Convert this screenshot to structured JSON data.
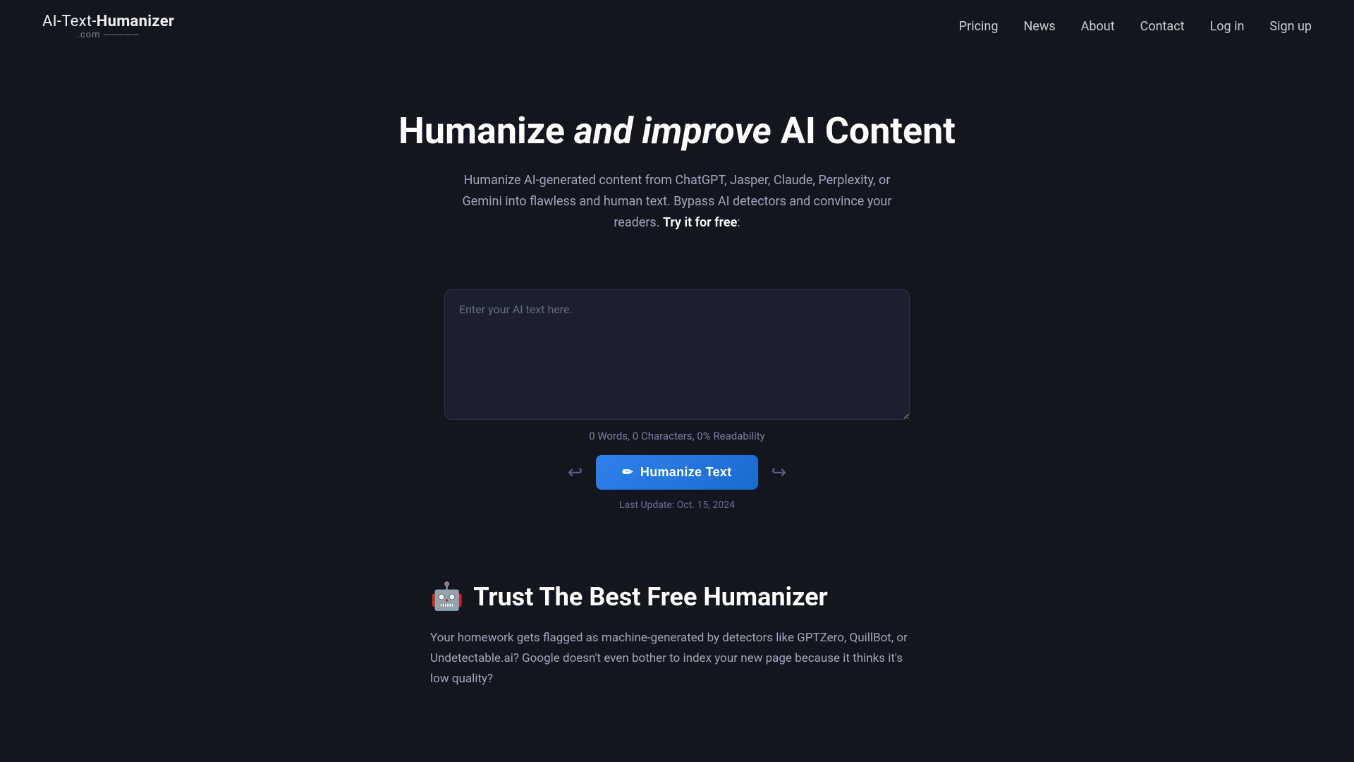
{
  "logo": {
    "text_part1": "AI-Text-",
    "text_part2": "Humanizer",
    "dot_text": ".com ─────"
  },
  "nav": {
    "items": [
      {
        "label": "Pricing",
        "href": "#"
      },
      {
        "label": "News",
        "href": "#"
      },
      {
        "label": "About",
        "href": "#"
      },
      {
        "label": "Contact",
        "href": "#"
      },
      {
        "label": "Log in",
        "href": "#"
      },
      {
        "label": "Sign up",
        "href": "#"
      }
    ]
  },
  "hero": {
    "title_part1": "Humanize ",
    "title_italic": "and improve",
    "title_part2": " AI Content",
    "description": "Humanize AI-generated content from ChatGPT, Jasper, Claude, Perplexity, or Gemini into flawless and human text. Bypass AI detectors and convince your readers.",
    "cta_inline": "Try it for free",
    "cta_suffix": ":"
  },
  "textarea": {
    "placeholder": "Enter your AI text here."
  },
  "stats": {
    "text": "0 Words, 0 Characters, 0% Readability"
  },
  "action": {
    "arrow_left": "↩",
    "arrow_right": "↪",
    "button_label": "Humanize Text",
    "pen_icon": "✏",
    "last_update": "Last Update: Oct. 15, 2024"
  },
  "trust": {
    "icon": "🤖",
    "heading": "Trust The Best Free Humanizer",
    "body": "Your homework gets flagged as machine-generated by detectors like GPTZero, QuillBot, or Undetectable.ai? Google doesn't even bother to index your new page because it thinks it's low quality?"
  }
}
